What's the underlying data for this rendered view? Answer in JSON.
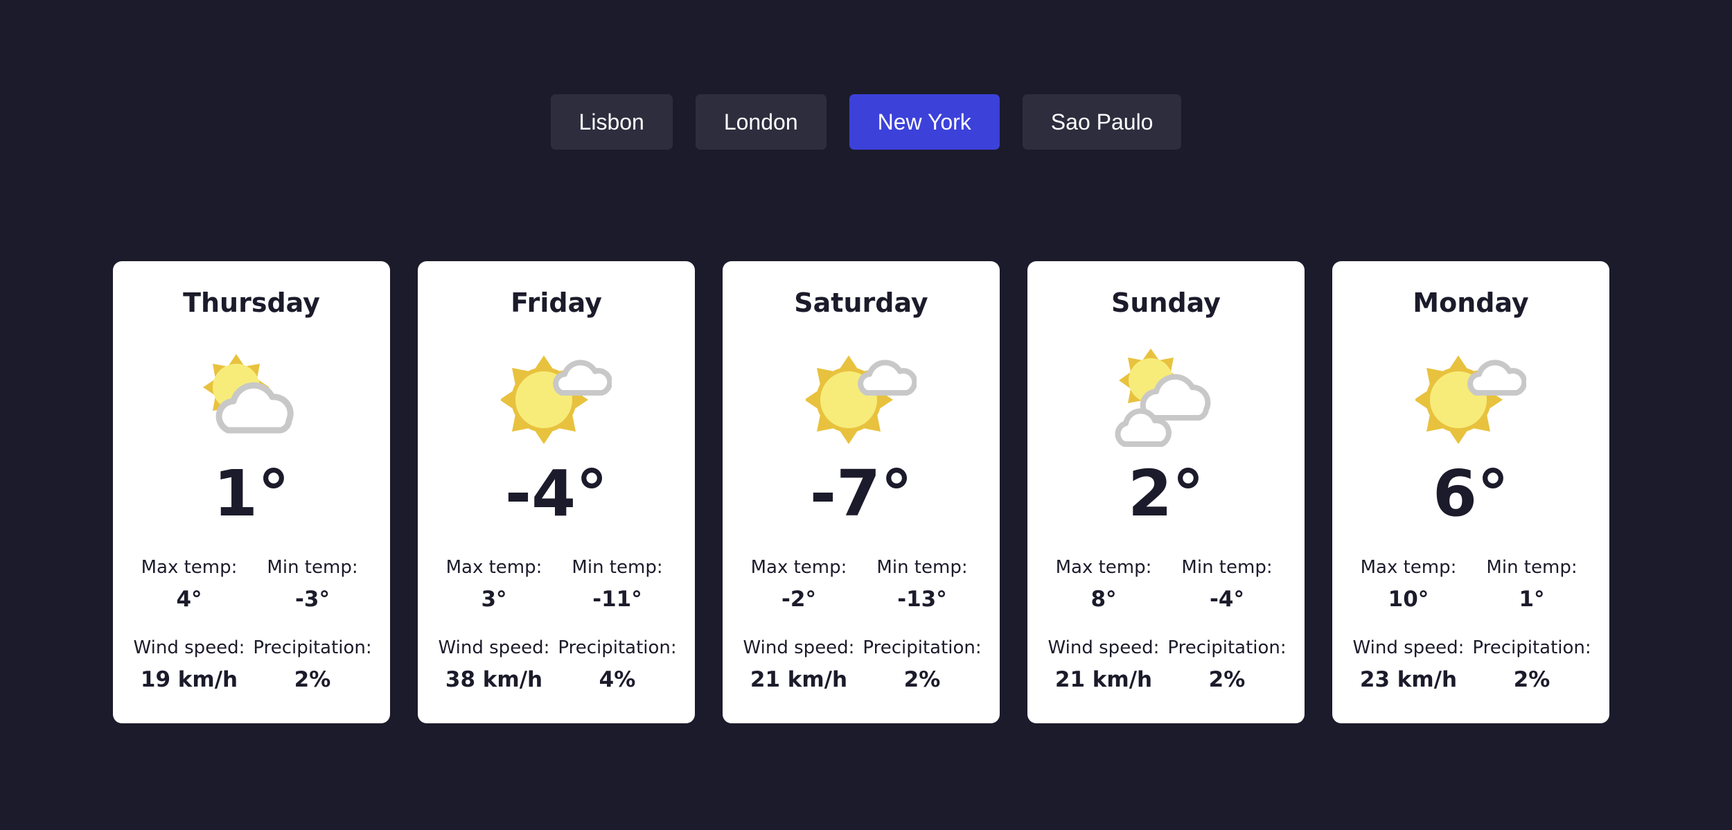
{
  "cities": {
    "tabs": [
      {
        "label": "Lisbon",
        "active": false
      },
      {
        "label": "London",
        "active": false
      },
      {
        "label": "New York",
        "active": true
      },
      {
        "label": "Sao Paulo",
        "active": false
      }
    ]
  },
  "colors": {
    "background": "#1c1b2b",
    "tab": "#2e2d3e",
    "tab_active": "#3c41da",
    "card": "#ffffff",
    "sun": "#f7ec7a",
    "sun_rays": "#e8c23e",
    "cloud_stroke": "#c8c8c8"
  },
  "forecast": [
    {
      "day": "Thursday",
      "icon": "sun-behind-cloud-icon",
      "temp": "1°",
      "max_label": "Max temp:",
      "max": "4°",
      "min_label": "Min temp:",
      "min": "-3°",
      "wind_label": "Wind speed:",
      "wind": "19 km/h",
      "precip_label": "Precipitation:",
      "precip": "2%"
    },
    {
      "day": "Friday",
      "icon": "sun-small-cloud-icon",
      "temp": "-4°",
      "max_label": "Max temp:",
      "max": "3°",
      "min_label": "Min temp:",
      "min": "-11°",
      "wind_label": "Wind speed:",
      "wind": "38 km/h",
      "precip_label": "Precipitation:",
      "precip": "4%"
    },
    {
      "day": "Saturday",
      "icon": "sun-small-cloud-icon",
      "temp": "-7°",
      "max_label": "Max temp:",
      "max": "-2°",
      "min_label": "Min temp:",
      "min": "-13°",
      "wind_label": "Wind speed:",
      "wind": "21 km/h",
      "precip_label": "Precipitation:",
      "precip": "2%"
    },
    {
      "day": "Sunday",
      "icon": "sun-two-clouds-icon",
      "temp": "2°",
      "max_label": "Max temp:",
      "max": "8°",
      "min_label": "Min temp:",
      "min": "-4°",
      "wind_label": "Wind speed:",
      "wind": "21 km/h",
      "precip_label": "Precipitation:",
      "precip": "2%"
    },
    {
      "day": "Monday",
      "icon": "sun-small-cloud-icon",
      "temp": "6°",
      "max_label": "Max temp:",
      "max": "10°",
      "min_label": "Min temp:",
      "min": "1°",
      "wind_label": "Wind speed:",
      "wind": "23 km/h",
      "precip_label": "Precipitation:",
      "precip": "2%"
    }
  ]
}
